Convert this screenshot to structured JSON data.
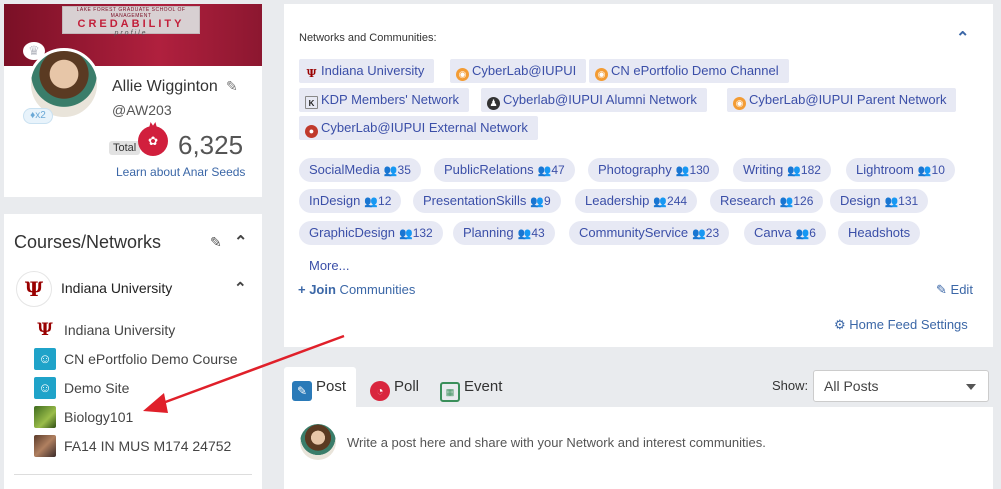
{
  "profile": {
    "cover_line1": "LAKE FOREST GRADUATE SCHOOL OF MANAGEMENT",
    "cover_line2": "CREDABILITY",
    "cover_line3": "profile",
    "name": "Allie Wigginton",
    "handle": "@AW203",
    "gem_label": "x2",
    "total_label": "Total",
    "seeds": "6,325",
    "learn_link": "Learn about Anar Seeds"
  },
  "courses": {
    "title": "Courses/Networks",
    "university": "Indiana University",
    "items": [
      {
        "label": "Indiana University"
      },
      {
        "label": "CN ePortfolio Demo Course"
      },
      {
        "label": "Demo Site"
      },
      {
        "label": "Biology101"
      },
      {
        "label": "FA14 IN MUS M174 24752"
      }
    ]
  },
  "networks": {
    "title": "Networks and Communities:",
    "chips": [
      {
        "label": "Indiana University"
      },
      {
        "label": "CyberLab@IUPUI"
      },
      {
        "label": "CN ePortfolio Demo Channel"
      },
      {
        "label": "KDP Members' Network"
      },
      {
        "label": "Cyberlab@IUPUI Alumni Network"
      },
      {
        "label": "CyberLab@IUPUI Parent Network"
      },
      {
        "label": "CyberLab@IUPUI External Network"
      }
    ],
    "tags": [
      {
        "label": "SocialMedia",
        "count": "35"
      },
      {
        "label": "PublicRelations",
        "count": "47"
      },
      {
        "label": "Photography",
        "count": "130"
      },
      {
        "label": "Writing",
        "count": "182"
      },
      {
        "label": "Lightroom",
        "count": "10"
      },
      {
        "label": "InDesign",
        "count": "12"
      },
      {
        "label": "PresentationSkills",
        "count": "9"
      },
      {
        "label": "Leadership",
        "count": "244"
      },
      {
        "label": "Research",
        "count": "126"
      },
      {
        "label": "Design",
        "count": "131"
      },
      {
        "label": "GraphicDesign",
        "count": "132"
      },
      {
        "label": "Planning",
        "count": "43"
      },
      {
        "label": "CommunityService",
        "count": "23"
      },
      {
        "label": "Canva",
        "count": "6"
      },
      {
        "label": "Headshots",
        "count": ""
      }
    ],
    "more": "More...",
    "join_prefix": "+ Join",
    "join_suffix": " Communities",
    "edit": "Edit",
    "feed_settings": "Home Feed Settings"
  },
  "compose": {
    "tabs": {
      "post": "Post",
      "poll": "Poll",
      "event": "Event"
    },
    "show_label": "Show:",
    "show_value": "All Posts",
    "placeholder": "Write a post here and share with your Network and interest communities."
  },
  "colors": {
    "accent": "#3b4fa8",
    "link": "#3b67a7",
    "chip_bg": "#e7e9f4",
    "arrow": "#e0202a"
  }
}
